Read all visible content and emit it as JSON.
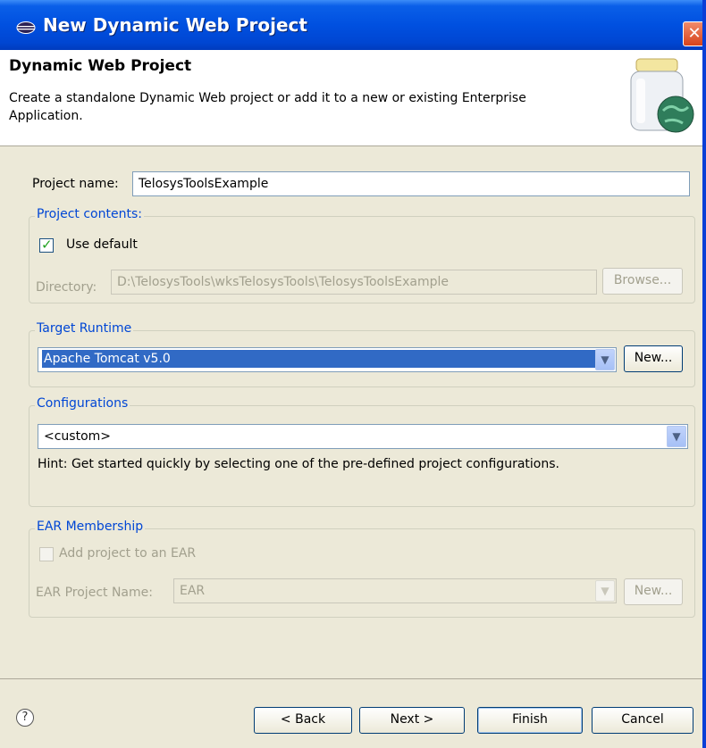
{
  "window": {
    "title": "New Dynamic Web Project",
    "close_glyph": "✕",
    "app_icon": "eclipse-icon"
  },
  "banner": {
    "title": "Dynamic Web Project",
    "description": "Create a standalone Dynamic Web project or add it to a new or existing Enterprise Application.",
    "icon": "web-project-jar-icon"
  },
  "project_name": {
    "label": "Project name:",
    "value": "TelosysToolsExample"
  },
  "project_contents": {
    "legend": "Project contents:",
    "use_default_label": "Use default",
    "use_default_checked": true,
    "directory_label": "Directory:",
    "directory_value": "D:\\TelosysTools\\wksTelosysTools\\TelosysToolsExample",
    "browse_label": "Browse..."
  },
  "target_runtime": {
    "legend": "Target Runtime",
    "selected": "Apache Tomcat v5.0",
    "new_label": "New..."
  },
  "configurations": {
    "legend": "Configurations",
    "selected": "<custom>",
    "hint": "Hint: Get started quickly by selecting one of the pre-defined project configurations."
  },
  "ear_membership": {
    "legend": "EAR Membership",
    "add_label": "Add project to an EAR",
    "add_checked": false,
    "ear_name_label": "EAR Project Name:",
    "ear_name_value": "EAR",
    "new_label": "New..."
  },
  "footer": {
    "help_glyph": "?",
    "back_label": "< Back",
    "next_label": "Next >",
    "finish_label": "Finish",
    "cancel_label": "Cancel"
  },
  "colors": {
    "titlebar": "#0050e0",
    "legend_text": "#0046d5",
    "selection": "#316ac5",
    "close_button": "#d7431b"
  }
}
